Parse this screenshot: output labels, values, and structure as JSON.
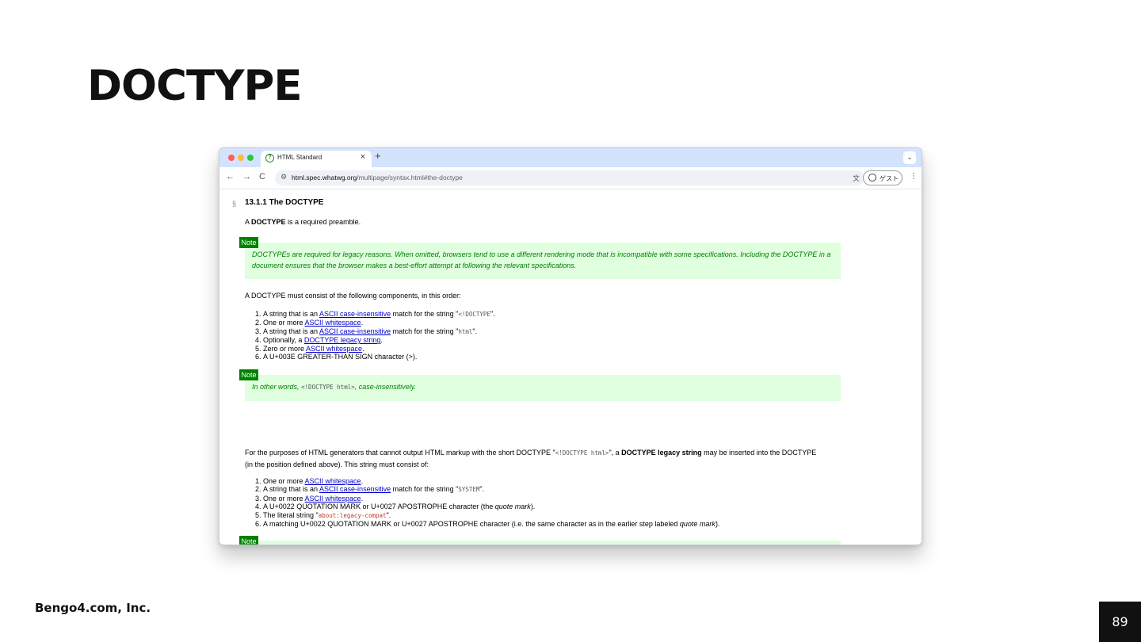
{
  "slide": {
    "title": "DOCTYPE",
    "company": "Bengo4.com, Inc.",
    "page_number": "89"
  },
  "browser": {
    "tab_title": "HTML Standard",
    "tab_close": "×",
    "new_tab": "+",
    "tab_menu": "⌄",
    "url_host": "html.spec.whatwg.org",
    "url_path": "/multipage/syntax.html#the-doctype",
    "profile_label": "ゲスト",
    "icons": {
      "back": "←",
      "forward": "→",
      "reload": "C",
      "site_settings": "⚙",
      "translate": "文",
      "menu": "⋮",
      "tab_favicon": "?"
    }
  },
  "doc": {
    "section_mark": "§",
    "heading": "13.1.1 The DOCTYPE",
    "intro": {
      "a": "A ",
      "bold": "DOCTYPE",
      "rest": " is a required preamble."
    },
    "note_label": "Note",
    "note1": "DOCTYPEs are required for legacy reasons. When omitted, browsers tend to use a different rendering mode that is incompatible with some specifications. Including the DOCTYPE in a document ensures that the browser makes a best-effort attempt at following the relevant specifications.",
    "components_intro": "A DOCTYPE must consist of the following components, in this order:",
    "list1": [
      {
        "pre": "A string that is an ",
        "link": "ASCII case-insensitive",
        "post": " match for the string \"",
        "code": "<!DOCTYPE",
        "end": "\"."
      },
      {
        "pre": "One or more ",
        "link": "ASCII whitespace",
        "post": ".",
        "code": "",
        "end": ""
      },
      {
        "pre": "A string that is an ",
        "link": "ASCII case-insensitive",
        "post": " match for the string \"",
        "code": "html",
        "end": "\"."
      },
      {
        "pre": "Optionally, a ",
        "link": "DOCTYPE legacy string",
        "post": ".",
        "code": "",
        "end": ""
      },
      {
        "pre": "Zero or more ",
        "link": "ASCII whitespace",
        "post": ".",
        "code": "",
        "end": ""
      },
      {
        "pre": "A U+003E GREATER-THAN SIGN character (>).",
        "link": "",
        "post": "",
        "code": "",
        "end": ""
      }
    ],
    "note2": {
      "a": "In other words, ",
      "code": "<!DOCTYPE html>",
      "b": ", case-insensitively."
    },
    "legacy_para": {
      "a": "For the purposes of HTML generators that cannot output HTML markup with the short DOCTYPE \"",
      "code": "<!DOCTYPE html>",
      "b": "\", a ",
      "bold": "DOCTYPE legacy string",
      "c": " may be inserted into the DOCTYPE (in the position defined above). This string must consist of:"
    },
    "list2": [
      {
        "pre": "One or more ",
        "link": "ASCII whitespace",
        "post": ".",
        "code": "",
        "end": ""
      },
      {
        "pre": "A string that is an ",
        "link": "ASCII case-insensitive",
        "post": " match for the string \"",
        "code": "SYSTEM",
        "end": "\"."
      },
      {
        "pre": "One or more ",
        "link": "ASCII whitespace",
        "post": ".",
        "code": "",
        "end": ""
      },
      {
        "pre": "A U+0022 QUOTATION MARK or U+0027 APOSTROPHE character (the ",
        "italic": "quote mark",
        "post": ").",
        "link": "",
        "code": "",
        "end": ""
      },
      {
        "pre": "The literal string \"",
        "code_orange": "about:legacy-compat",
        "post": "\".",
        "link": "",
        "code": "",
        "end": ""
      },
      {
        "pre": "A matching U+0022 QUOTATION MARK or U+0027 APOSTROPHE character (i.e. the same character as in the earlier step labeled ",
        "italic": "quote mark",
        "post": ").",
        "link": "",
        "code": "",
        "end": ""
      }
    ]
  },
  "colors": {
    "note_bg": "#dfffdf",
    "note_label": "#008000",
    "link": "#0000cc",
    "tab_strip": "#d3e3fd"
  }
}
